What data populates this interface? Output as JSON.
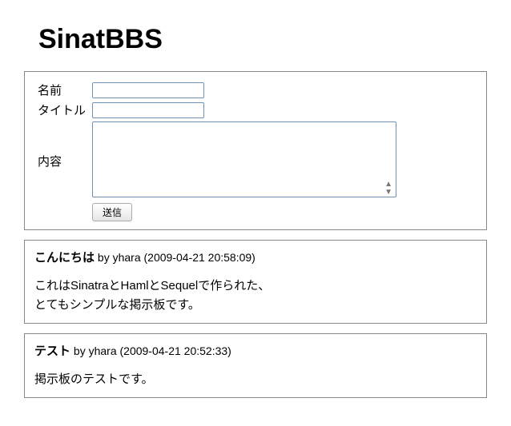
{
  "page_title": "SinatBBS",
  "form": {
    "name_label": "名前",
    "title_label": "タイトル",
    "body_label": "内容",
    "submit_label": "送信"
  },
  "posts": [
    {
      "title": "こんにちは",
      "meta": " by yhara (2009-04-21 20:58:09)",
      "body": "これはSinatraとHamlとSequelで作られた、\nとてもシンプルな掲示板です。"
    },
    {
      "title": "テスト",
      "meta": " by yhara (2009-04-21 20:52:33)",
      "body": "掲示板のテストです。"
    }
  ]
}
